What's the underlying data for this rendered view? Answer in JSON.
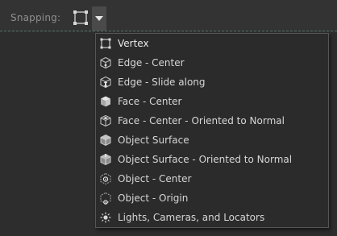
{
  "toolbar": {
    "snapping_label": "Snapping:",
    "current_mode_icon": "vertex-snap-icon",
    "dropdown_icon": "triangle-down-icon"
  },
  "menu": {
    "items": [
      {
        "label": "Vertex",
        "icon": "vertex-snap-icon"
      },
      {
        "label": "Edge - Center",
        "icon": "cube-edge-center-icon"
      },
      {
        "label": "Edge - Slide along",
        "icon": "cube-edge-slide-icon"
      },
      {
        "label": "Face - Center",
        "icon": "cube-face-center-icon"
      },
      {
        "label": "Face - Center - Oriented to Normal",
        "icon": "cube-face-normal-icon"
      },
      {
        "label": "Object Surface",
        "icon": "object-surface-icon"
      },
      {
        "label": "Object Surface - Oriented to Normal",
        "icon": "object-surface-normal-icon"
      },
      {
        "label": "Object - Center",
        "icon": "object-center-icon"
      },
      {
        "label": "Object - Origin",
        "icon": "object-origin-icon"
      },
      {
        "label": "Lights, Cameras, and Locators",
        "icon": "light-icon"
      }
    ]
  },
  "colors": {
    "background": "#2d2d2d",
    "toolbar": "#333333",
    "menu_bg": "#2b2b2b",
    "menu_border": "#555555",
    "text": "#d6d6d6",
    "label_text": "#8f8f8f",
    "accent_dashed": "#4f6f66"
  }
}
